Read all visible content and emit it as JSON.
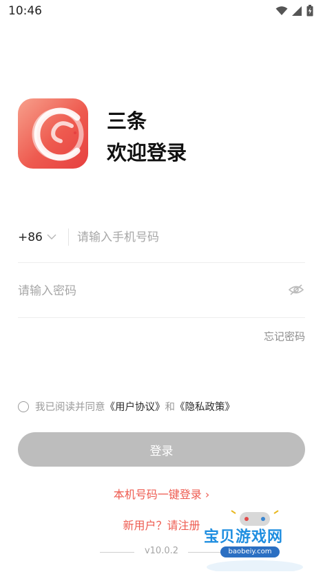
{
  "status_bar": {
    "time": "10:46",
    "icons": [
      "wifi-icon",
      "signal-icon",
      "battery-icon"
    ]
  },
  "brand": {
    "title": "三条",
    "subtitle": "欢迎登录",
    "logo_colors": [
      "#f7a08c",
      "#ee5a4f",
      "#e64040"
    ]
  },
  "phone": {
    "country_code": "+86",
    "placeholder": "请输入手机号码",
    "value": ""
  },
  "password": {
    "placeholder": "请输入密码",
    "value": "",
    "toggle_icon": "eye-hidden-icon"
  },
  "forgot_label": "忘记密码",
  "agreement": {
    "prefix": "我已阅读并同意",
    "user_agreement": "《用户协议》",
    "and": "和",
    "privacy_policy": "《隐私政策》",
    "checked": false
  },
  "login_label": "登录",
  "quick_login_label": "本机号码一键登录 ›",
  "register_label": "新用户？请注册",
  "version": "v10.0.2",
  "watermark": {
    "text": "宝贝游戏网",
    "url": "baobeiy.com"
  },
  "colors": {
    "accent": "#ee5b50",
    "button_disabled": "#bdbdbd",
    "placeholder": "#a7a7a7"
  }
}
